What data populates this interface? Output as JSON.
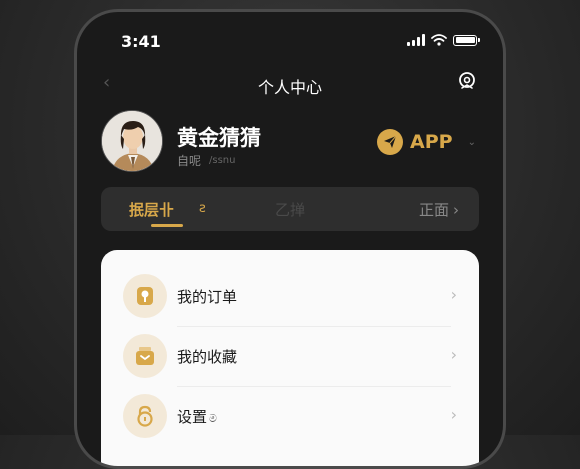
{
  "status_bar": {
    "time": "3:41"
  },
  "nav": {
    "back_icon": "chevron-left-icon",
    "title": "个人中心",
    "action_icon": "support-icon"
  },
  "profile": {
    "name": "黄金猜猜",
    "sub_label": "自呢",
    "sub_value": "/ssnu"
  },
  "app_badge": {
    "label": "APP",
    "chevron": "⌄"
  },
  "tabs": [
    {
      "label": "抿层卝",
      "mark": "ƨ"
    },
    {
      "label": "乙掸"
    },
    {
      "label": "正面",
      "chevron": "›"
    }
  ],
  "menu": [
    {
      "label": "我的订单",
      "suffix": "",
      "icon": "pin-icon"
    },
    {
      "label": "我的收藏",
      "suffix": "",
      "icon": "box-icon"
    },
    {
      "label": "设置",
      "suffix": "ම",
      "icon": "lock-icon"
    }
  ],
  "colors": {
    "accent": "#d8a84a",
    "background": "#1a1a1a",
    "card": "#fafafa"
  }
}
